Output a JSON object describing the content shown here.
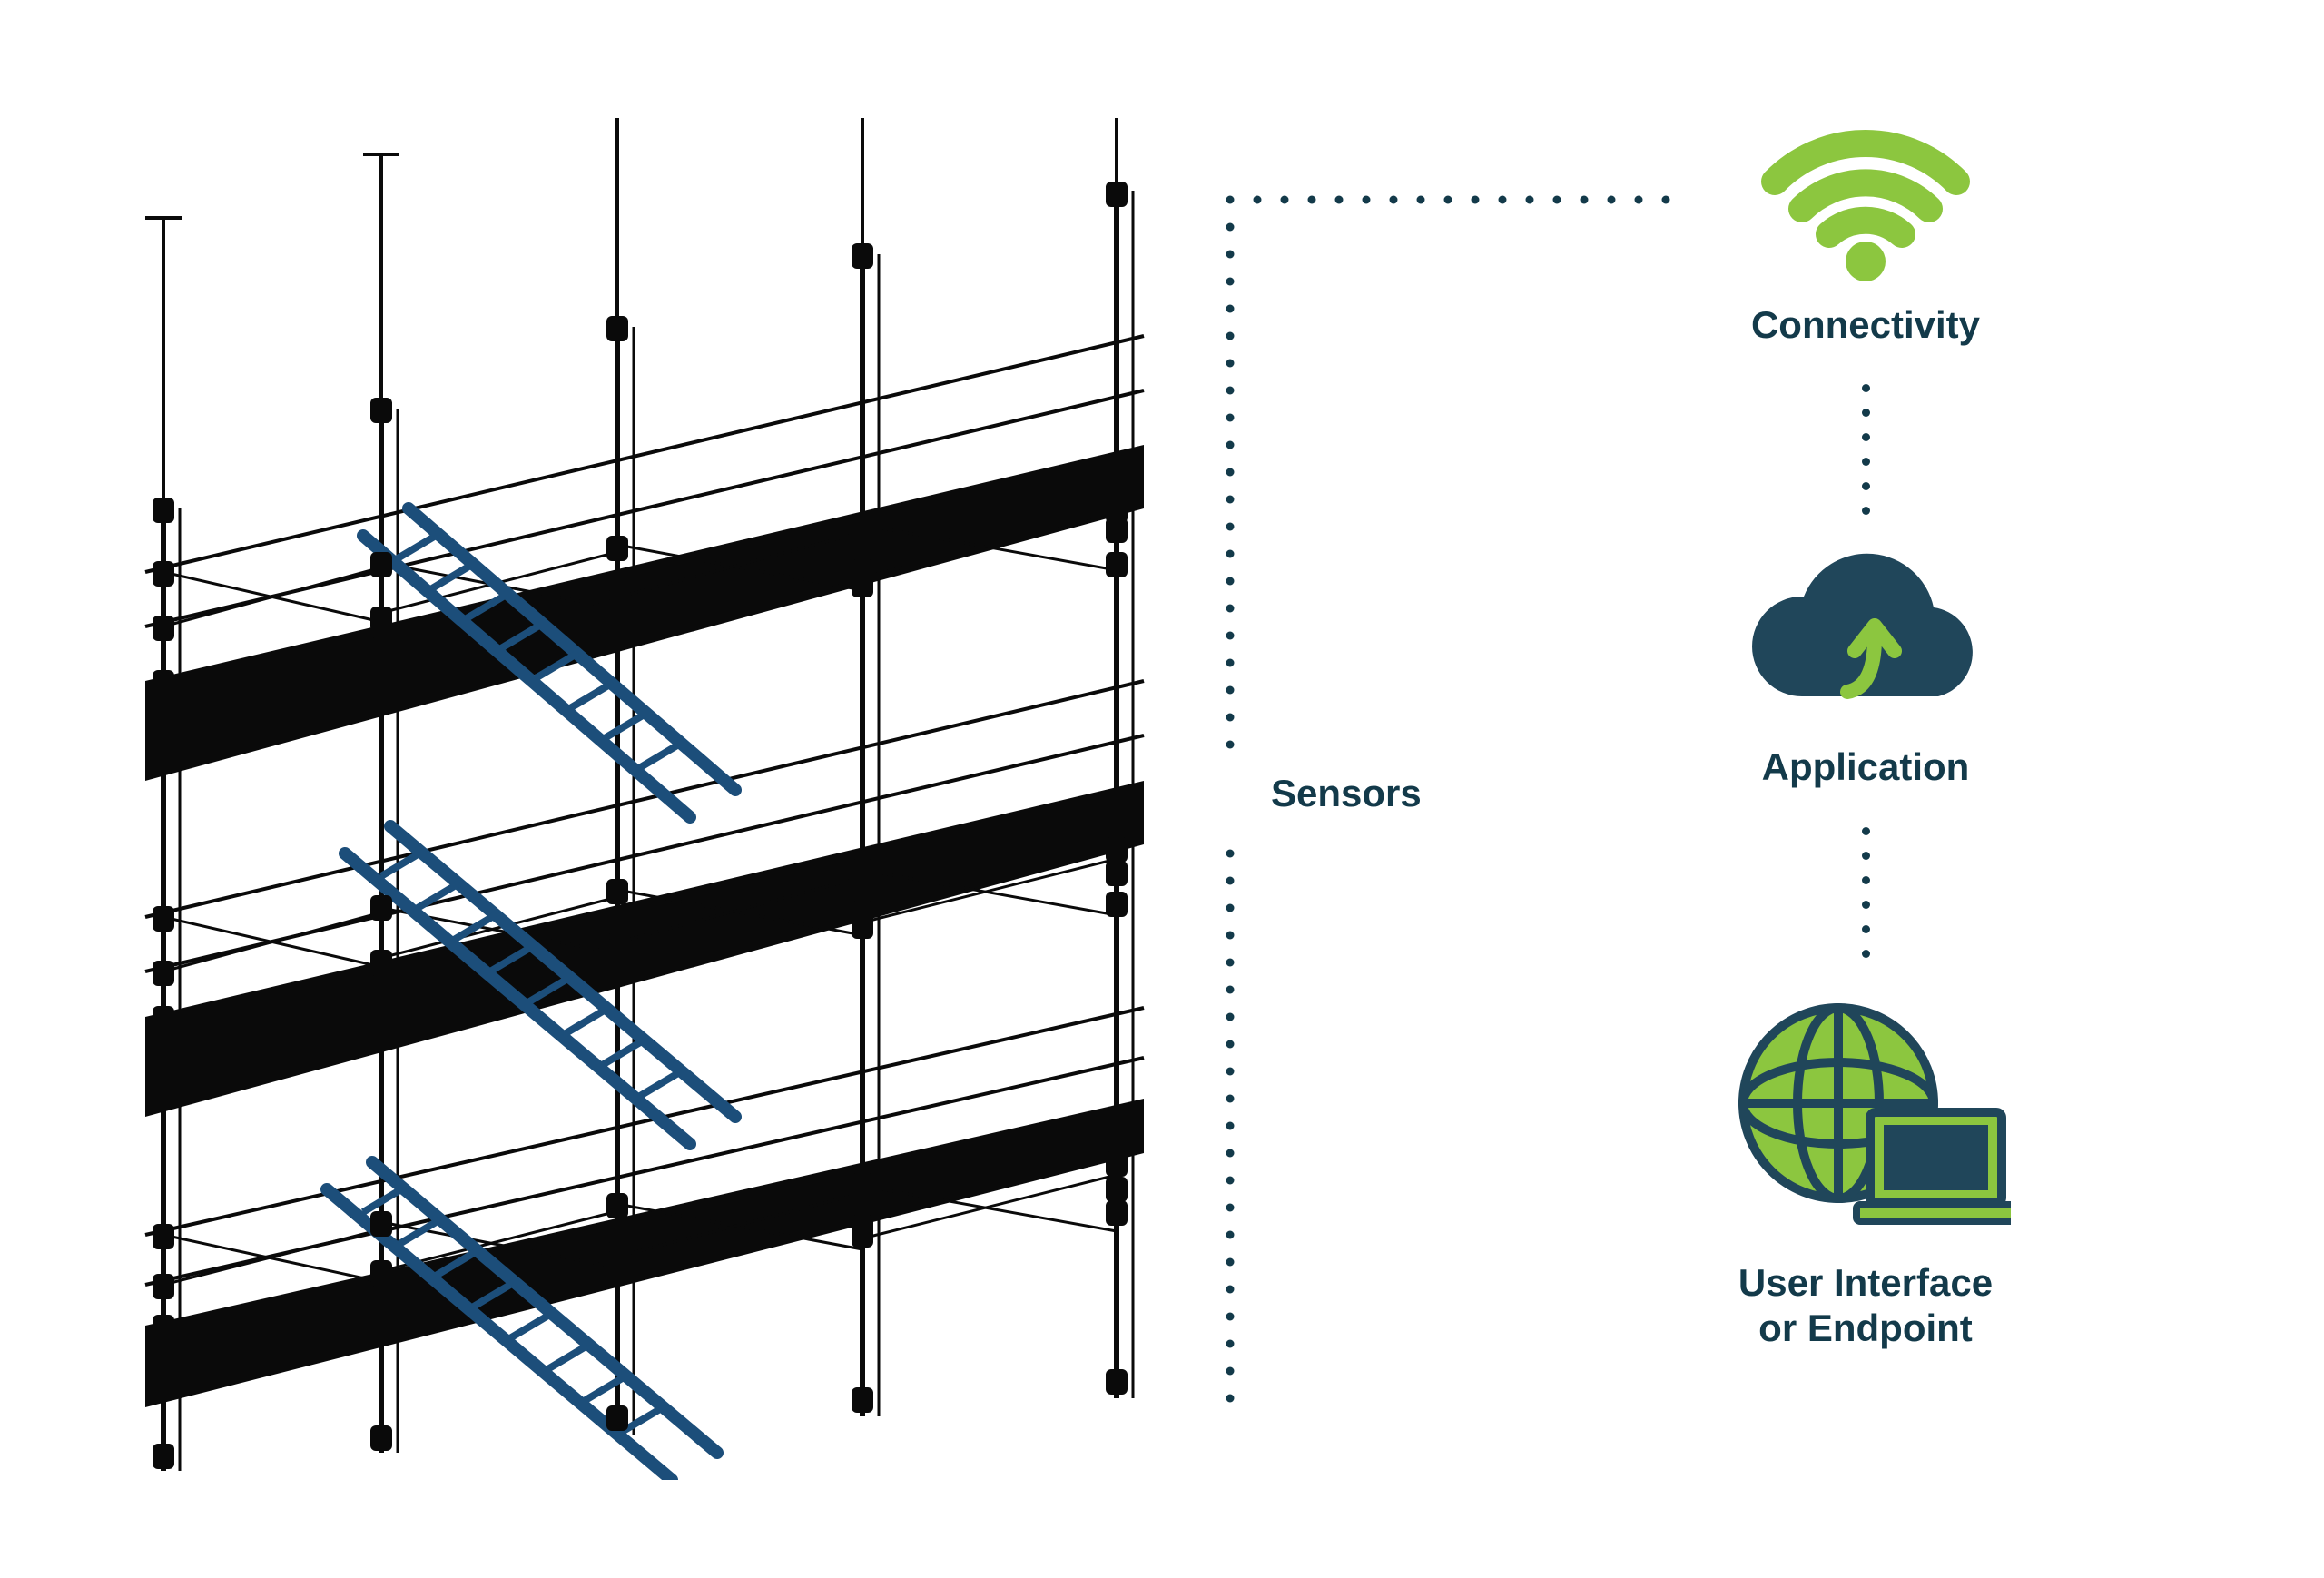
{
  "diagram": {
    "labels": {
      "sensors": "Sensors",
      "connectivity": "Connectivity",
      "application": "Application",
      "endpoint_line1": "User Interface",
      "endpoint_line2": "or Endpoint"
    },
    "colors": {
      "accent_green": "#8CC63F",
      "dark_navy": "#163B4D",
      "ladder_blue": "#1C4E7A",
      "black": "#0A0A0A"
    },
    "flow_order": [
      "Sensors",
      "Connectivity",
      "Application",
      "User Interface or Endpoint"
    ],
    "description": "IoT architecture: construction scaffold with sensor clamps, dotted connector to a vertical flow of Connectivity (wifi), Application (cloud with upload arrow), and User Interface / Endpoint (globe + laptop)."
  }
}
